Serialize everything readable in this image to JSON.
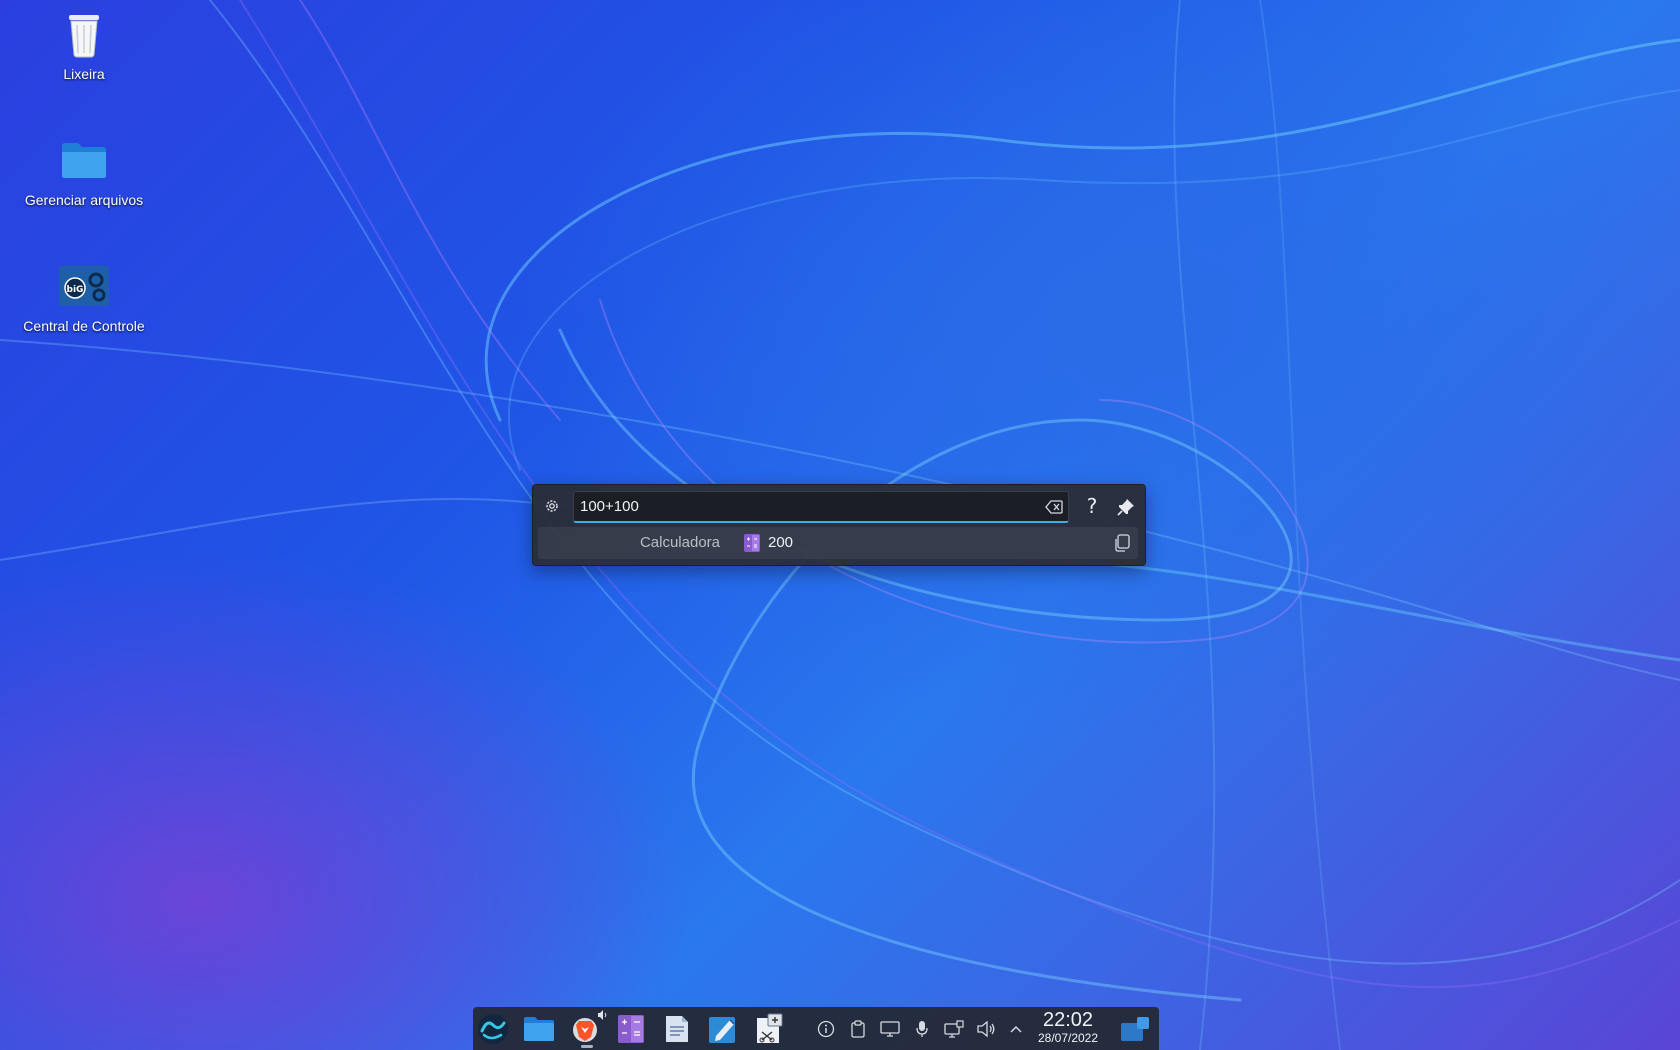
{
  "desktop": {
    "icons": [
      {
        "label": "Lixeira",
        "icon": "trash-icon"
      },
      {
        "label": "Gerenciar arquivos",
        "icon": "folder-icon"
      },
      {
        "label": "Central de Controle",
        "icon": "control-center-icon"
      }
    ]
  },
  "krunner": {
    "query": "100+100",
    "help_label": "?",
    "result": {
      "runner": "Calculadora",
      "value": "200",
      "icon": "calculator-icon"
    },
    "accent_color": "#3daee9"
  },
  "taskbar": {
    "apps": [
      {
        "icon": "biglinux-menu-icon"
      },
      {
        "icon": "file-manager-icon"
      },
      {
        "icon": "brave-browser-icon",
        "active": true,
        "audio": true
      },
      {
        "icon": "calculator-icon"
      },
      {
        "icon": "text-editor-icon"
      },
      {
        "icon": "kate-icon"
      },
      {
        "icon": "screenshot-icon"
      }
    ],
    "tray": [
      {
        "icon": "info-icon"
      },
      {
        "icon": "clipboard-icon"
      },
      {
        "icon": "display-icon"
      },
      {
        "icon": "microphone-icon"
      },
      {
        "icon": "network-icon"
      },
      {
        "icon": "volume-icon"
      },
      {
        "icon": "chevron-up-icon"
      }
    ],
    "clock": {
      "time": "22:02",
      "date": "28/07/2022"
    }
  }
}
